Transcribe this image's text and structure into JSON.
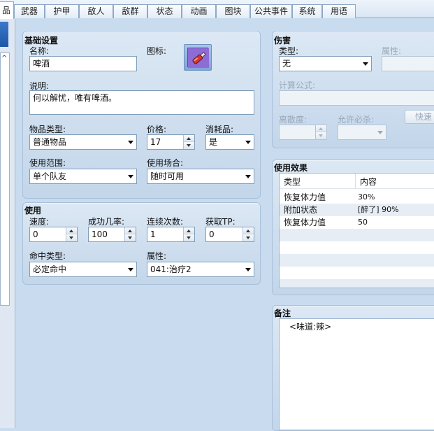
{
  "tabs": [
    "品",
    "武器",
    "护甲",
    "敌人",
    "敌群",
    "状态",
    "动画",
    "图块",
    "公共事件",
    "系统",
    "用语"
  ],
  "basic": {
    "title": "基础设置",
    "name_label": "名称:",
    "name_value": "啤酒",
    "icon_label": "图标:",
    "desc_label": "说明:",
    "desc_value": "何以解忧，唯有啤酒。",
    "item_type_label": "物品类型:",
    "item_type_value": "普通物品",
    "price_label": "价格:",
    "price_value": "17",
    "consumable_label": "消耗品:",
    "consumable_value": "是",
    "scope_label": "使用范围:",
    "scope_value": "单个队友",
    "occasion_label": "使用场合:",
    "occasion_value": "随时可用"
  },
  "use": {
    "title": "使用",
    "speed_label": "速度:",
    "speed_value": "0",
    "success_label": "成功几率:",
    "success_value": "100",
    "repeats_label": "连续次数:",
    "repeats_value": "1",
    "tp_label": "获取TP:",
    "tp_value": "0",
    "hit_type_label": "命中类型:",
    "hit_type_value": "必定命中",
    "element_label": "属性:",
    "element_value": "041:治疗2"
  },
  "damage": {
    "title": "伤害",
    "type_label": "类型:",
    "type_value": "无",
    "element_label": "属性:",
    "formula_label": "计算公式:",
    "variance_label": "离散度:",
    "critical_label": "允许必杀:",
    "quick_button": "快速"
  },
  "effects": {
    "title": "使用效果",
    "col_type": "类型",
    "col_content": "内容",
    "rows": [
      {
        "type": "恢复体力值",
        "content": "30%"
      },
      {
        "type": "附加状态",
        "content": "[醉了] 90%"
      },
      {
        "type": "恢复体力值",
        "content": "50"
      }
    ]
  },
  "note": {
    "title": "备注",
    "value": "<味道:辣>"
  },
  "colors": {
    "background": "#c9dcef",
    "group_top": "#dce8f4",
    "group_bottom": "#c3d6ea",
    "icon_purple": "#8e6cd6"
  }
}
